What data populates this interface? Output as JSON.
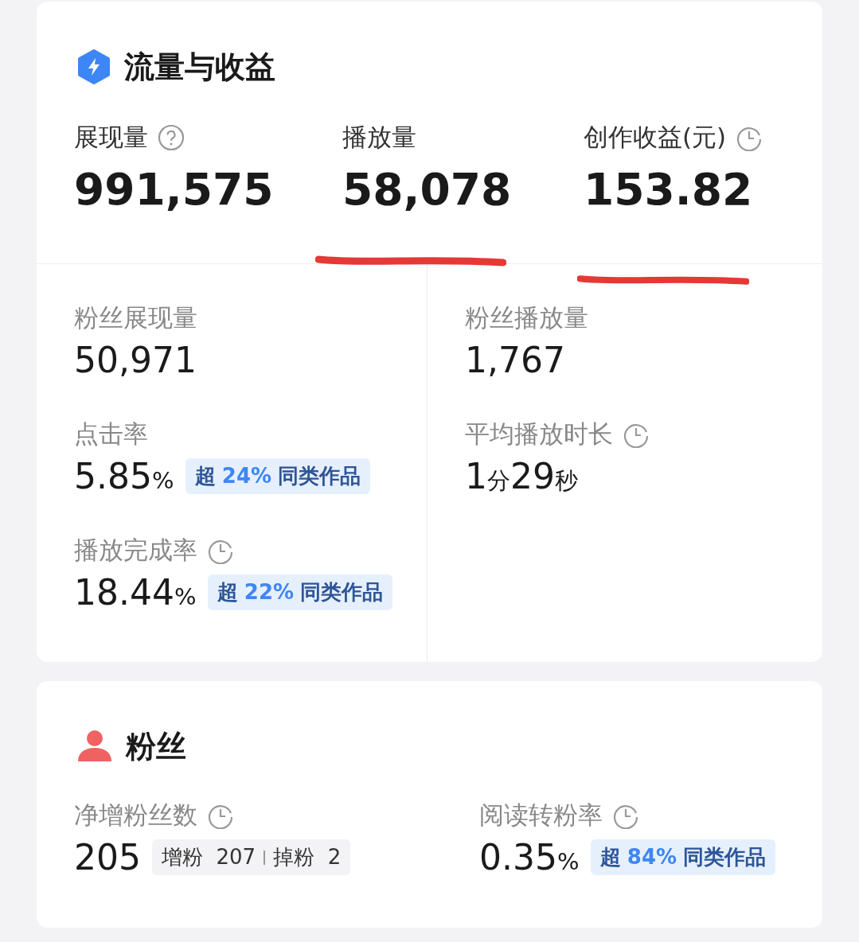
{
  "traffic": {
    "title": "流量与收益",
    "top_metrics": [
      {
        "label": "展现量",
        "help_icon": true,
        "value": "991,575",
        "underlined": false
      },
      {
        "label": "播放量",
        "value": "58,078",
        "underlined": true
      },
      {
        "label": "创作收益(元)",
        "clock_icon": true,
        "value": "153.82",
        "underlined": true
      }
    ],
    "left_metrics": [
      {
        "label": "粉丝展现量",
        "value": [
          {
            "text": "50,971",
            "kind": "number"
          }
        ]
      },
      {
        "label": "点击率",
        "value": [
          {
            "text": "5.85",
            "kind": "number"
          },
          {
            "text": "%",
            "kind": "unit"
          }
        ],
        "badge": {
          "prefix": "超",
          "value": "24%",
          "suffix": "同类作品"
        }
      },
      {
        "label": "播放完成率",
        "clock_icon": true,
        "value": [
          {
            "text": "18.44",
            "kind": "number"
          },
          {
            "text": "%",
            "kind": "unit"
          }
        ],
        "badge": {
          "prefix": "超",
          "value": "22%",
          "suffix": "同类作品"
        }
      }
    ],
    "right_metrics": [
      {
        "label": "粉丝播放量",
        "value": [
          {
            "text": "1,767",
            "kind": "number"
          }
        ]
      },
      {
        "label": "平均播放时长",
        "clock_icon": true,
        "value": [
          {
            "text": "1",
            "kind": "number"
          },
          {
            "text": "分",
            "kind": "unit"
          },
          {
            "text": "29",
            "kind": "number"
          },
          {
            "text": "秒",
            "kind": "unit"
          }
        ]
      }
    ]
  },
  "fans": {
    "title": "粉丝",
    "metrics": [
      {
        "label": "净增粉丝数",
        "clock_icon": true,
        "value": [
          {
            "text": "205",
            "kind": "number"
          }
        ],
        "breakdown": [
          {
            "label": "增粉",
            "value": "207"
          },
          {
            "label": "掉粉",
            "value": "2"
          }
        ]
      },
      {
        "label": "阅读转粉率",
        "clock_icon": true,
        "value": [
          {
            "text": "0.35",
            "kind": "number"
          },
          {
            "text": "%",
            "kind": "unit"
          }
        ],
        "badge": {
          "prefix": "超",
          "value": "84%",
          "suffix": "同类作品"
        }
      }
    ]
  }
}
